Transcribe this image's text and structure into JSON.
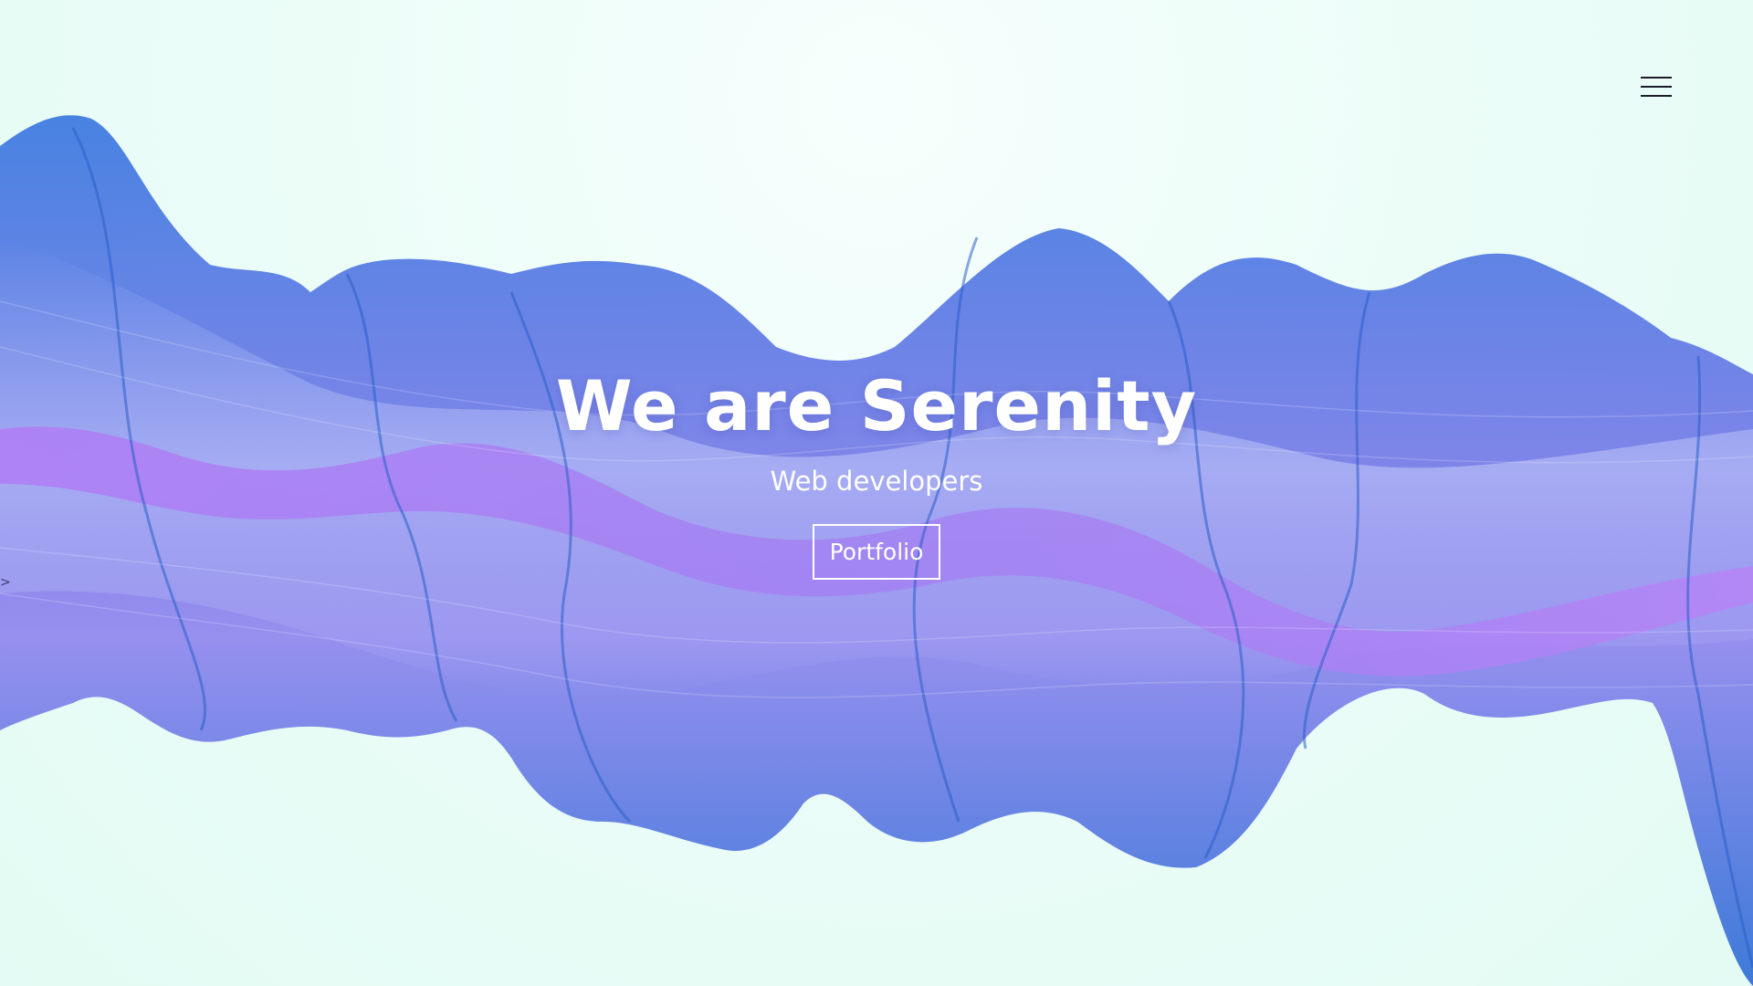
{
  "hero": {
    "title": "We are Serenity",
    "subtitle": "Web developers",
    "button_label": "Portfolio"
  },
  "header": {
    "menu_icon": "hamburger-menu-icon"
  },
  "slider": {
    "prev_glyph": ">"
  },
  "colors": {
    "background": "#e8fdf8",
    "wave_blue": "#2f6fd6",
    "wave_violet": "#9a6bf0",
    "text": "#ffffff"
  }
}
